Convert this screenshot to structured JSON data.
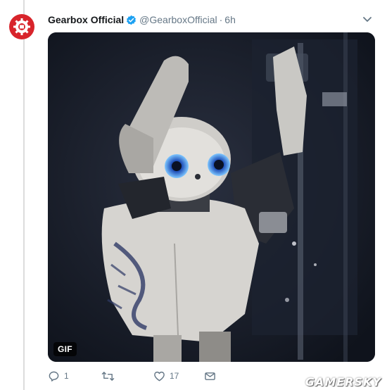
{
  "tweet": {
    "display_name": "Gearbox Official",
    "handle": "@GearboxOfficial",
    "separator": "·",
    "time": "6h",
    "verified": true,
    "avatar_icon": "gearbox-logo",
    "brand_color": "#d8242b",
    "media": {
      "badge": "GIF",
      "subject": "robot"
    },
    "actions": {
      "reply_count": "1",
      "retweet_count": "",
      "like_count": "17"
    }
  },
  "watermark": "GAMERSKY"
}
